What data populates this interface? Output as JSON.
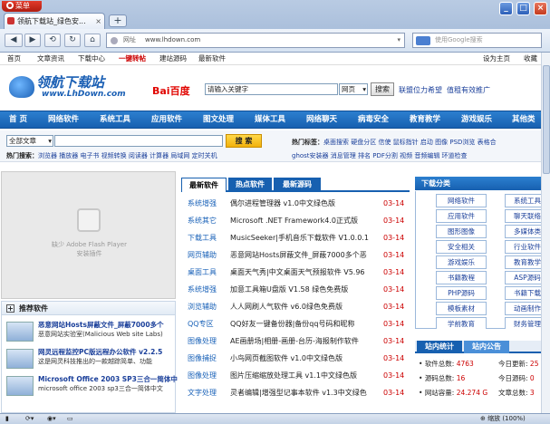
{
  "browser": {
    "menu_label": "菜单",
    "tab_title": "领航下载站_绿色安...",
    "tab_close": "×",
    "new_tab": "+",
    "win_min": "_",
    "win_max": "□",
    "win_close": "×",
    "address_label": "网址",
    "address_value": "www.lhdown.com",
    "search_placeholder": "使用Google搜索"
  },
  "topbar": {
    "left": [
      "首页",
      "文章资讯",
      "下载中心",
      "一键转帖",
      "建站源码",
      "最新软件"
    ],
    "right": [
      "设为主页",
      "收藏"
    ]
  },
  "header": {
    "logo_cn": "领航下载站",
    "logo_en": "www.LhDown.com",
    "baidu_label": "Bai百度",
    "keyword_value": "请输入关键字",
    "search_scope": "网页",
    "search_button": "搜索",
    "link1": "联盟位力希望",
    "link2": "值租有效推广"
  },
  "mainnav": [
    "首  页",
    "网络软件",
    "系统工具",
    "应用软件",
    "图文处理",
    "媒体工具",
    "网络聊天",
    "病毒安全",
    "教育教学",
    "游戏娱乐",
    "其他类"
  ],
  "searchbar": {
    "category": "全部文章",
    "button": "搜  索",
    "hot_tags_label": "热门标签：",
    "hot_tags": "桌面搜索  硬盘分区  信使  鼠标指针  启动  图像  PSD浏览  表格合",
    "hot_search_label": "热门搜索：",
    "hot_search": "浏览器  播放器  电子书  视频转换  阅读器  计算器  局域网  定时关机",
    "row2_right": "ghost安装器  消息管理  排名  PDF分割  视频  音频编辑  环道检查"
  },
  "flash": {
    "line1": "缺少 Adobe Flash Player",
    "line2": "安装插件"
  },
  "recommend": {
    "title": "推荐软件",
    "items": [
      {
        "title": "恶意网站Hosts屏蔽文件_屏蔽7000多个",
        "desc": "恶意网站实验室(Malicious Web site Labs)"
      },
      {
        "title": "网灵远程监控PC版远程办公软件 v2.2.5",
        "desc": "这是网灵科技推出的一款越踪简单、功能"
      },
      {
        "title": "Microsoft Office 2003 SP3三合一简体中",
        "desc": "microsoft office 2003 sp3三合一简体中文"
      }
    ]
  },
  "midtabs": [
    "最新软件",
    "热点软件",
    "最新源码"
  ],
  "software_list": [
    {
      "cat": "系统增强",
      "title": "偶尔进程管理器 v1.0中文绿色版",
      "date": "03-14"
    },
    {
      "cat": "系统其它",
      "title": "Microsoft .NET Framework4.0正式版",
      "date": "03-14"
    },
    {
      "cat": "下载工具",
      "title": "MusicSeeker|手机音乐下载软件 V1.0.0.1",
      "date": "03-14"
    },
    {
      "cat": "网页辅助",
      "title": "恶意网站Hosts屏蔽文件_屏蔽7000多个恶",
      "date": "03-14"
    },
    {
      "cat": "桌面工具",
      "title": "桌面天气秀|中文桌面天气预报软件 V5.96",
      "date": "03-14"
    },
    {
      "cat": "系统增强",
      "title": "加意工具箱U盘版 V1.58 绿色免费版",
      "date": "03-14"
    },
    {
      "cat": "浏览辅助",
      "title": "人人网刷人气软件 v6.0绿色免费版",
      "date": "03-14"
    },
    {
      "cat": "QQ专区",
      "title": "QQ好友一键备份器|备份qq号码和昵称",
      "date": "03-14"
    },
    {
      "cat": "图像处理",
      "title": "AE画册场|相册-画册-台历-海报制作软件",
      "date": "03-14"
    },
    {
      "cat": "图像捕捉",
      "title": "小鸟网页截图软件 v1.0中文绿色版",
      "date": "03-14"
    },
    {
      "cat": "图像处理",
      "title": "图片压缩缩放处理工具 v1.1中文绿色版",
      "date": "03-14"
    },
    {
      "cat": "文字处理",
      "title": "灵者编辑|增强型记事本软件 v1.3中文绿色",
      "date": "03-14"
    }
  ],
  "categories": {
    "title": "下载分类",
    "items": [
      [
        "网络软件",
        "系统工具"
      ],
      [
        "应用软件",
        "聊天联络"
      ],
      [
        "图形图像",
        "多媒体类"
      ],
      [
        "安全相关",
        "行业软件"
      ],
      [
        "游戏娱乐",
        "教育教学"
      ],
      [
        "书籍教程",
        "ASP源码"
      ],
      [
        "PHP源码",
        "书籍下载"
      ],
      [
        "模板素材",
        "动画制作"
      ],
      [
        "学前教育",
        "财务管理"
      ]
    ]
  },
  "stats": {
    "tabs": [
      "站内统计",
      "站内公告"
    ],
    "rows": [
      {
        "l": "软件总数:",
        "lv": "4763",
        "r": "今日更新:",
        "rv": "25"
      },
      {
        "l": "源码总数:",
        "lv": "16",
        "r": "今日源码:",
        "rv": "0"
      },
      {
        "l": "网站容量:",
        "lv": "24.274 G",
        "r": "文章总数:",
        "rv": "3"
      }
    ]
  },
  "status": {
    "zoom": "缩放 (100%)"
  }
}
